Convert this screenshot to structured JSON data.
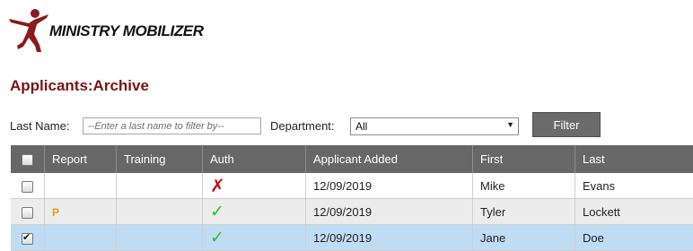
{
  "app": {
    "logo_text": "MINISTRY MOBILIZER"
  },
  "page": {
    "title": "Applicants:Archive"
  },
  "filters": {
    "last_name_label": "Last Name:",
    "last_name_placeholder": "--Enter a last name to filter by--",
    "department_label": "Department:",
    "department_value": "All",
    "filter_button": "Filter"
  },
  "table": {
    "columns": [
      "Report",
      "Training",
      "Auth",
      "Applicant Added",
      "First",
      "Last"
    ],
    "rows": [
      {
        "checked": false,
        "report": "",
        "training": "",
        "auth": "✗",
        "auth_status": "denied",
        "added": "12/09/2019",
        "first": "Mike",
        "last": "Evans"
      },
      {
        "checked": false,
        "report": "P",
        "training": "",
        "auth": "✓",
        "auth_status": "approved",
        "added": "12/09/2019",
        "first": "Tyler",
        "last": "Lockett"
      },
      {
        "checked": true,
        "report": "",
        "training": "",
        "auth": "✓",
        "auth_status": "approved",
        "added": "12/09/2019",
        "first": "Jane",
        "last": "Doe"
      }
    ]
  },
  "colors": {
    "title": "#7a1414",
    "header_bg": "#676767",
    "selected_row": "#bfdcf5",
    "deny": "#c41212",
    "approve": "#28c428",
    "report_flag": "#e89a1a",
    "logo": "#8b1a1a"
  }
}
